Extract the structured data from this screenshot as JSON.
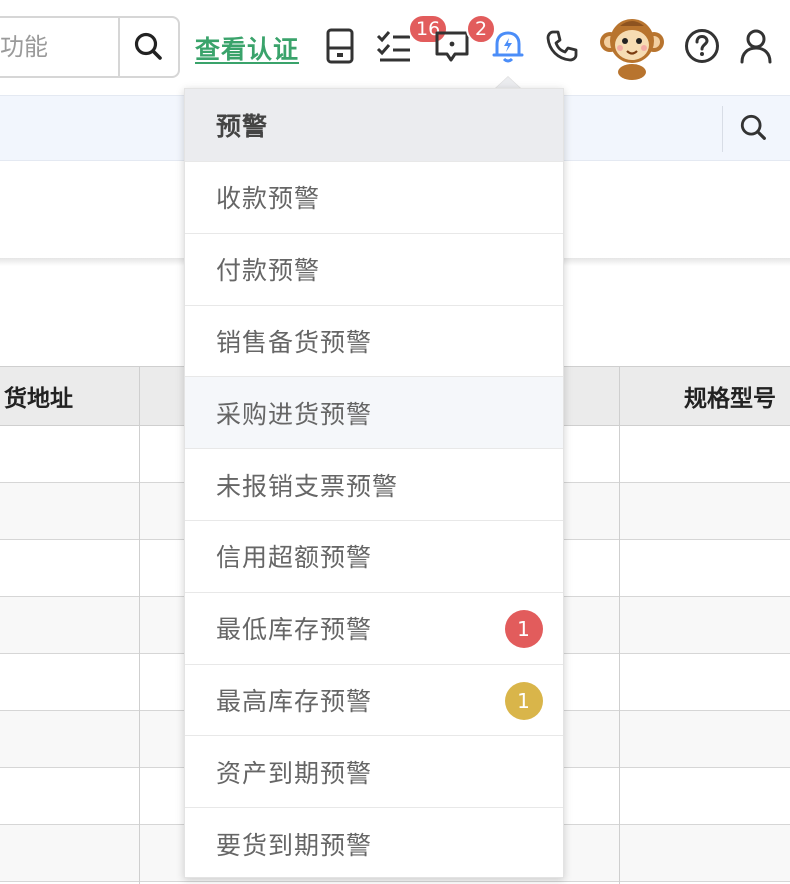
{
  "search": {
    "placeholder": "功能"
  },
  "header": {
    "auth_link": "查看认证",
    "todo_badge": "16",
    "message_badge": "2",
    "icons": [
      "calculator-icon",
      "todo-list-icon",
      "message-icon",
      "bell-icon",
      "phone-icon",
      "help-icon",
      "user-icon"
    ]
  },
  "table": {
    "columns": [
      "货地址",
      "规格型号"
    ]
  },
  "dropdown": {
    "title": "预警",
    "items": [
      {
        "label": "收款预警",
        "count": ""
      },
      {
        "label": "付款预警",
        "count": ""
      },
      {
        "label": "销售备货预警",
        "count": ""
      },
      {
        "label": "采购进货预警",
        "count": ""
      },
      {
        "label": "未报销支票预警",
        "count": ""
      },
      {
        "label": "信用超额预警",
        "count": ""
      },
      {
        "label": "最低库存预警",
        "count": "1"
      },
      {
        "label": "最高库存预警",
        "count": "1"
      },
      {
        "label": "资产到期预警",
        "count": ""
      },
      {
        "label": "要货到期预警",
        "count": ""
      }
    ]
  },
  "colors": {
    "accent_green": "#3aa36b",
    "bell_active": "#4b8df8",
    "badge_red": "#e25c5c",
    "badge_gold": "#d9b54a"
  }
}
